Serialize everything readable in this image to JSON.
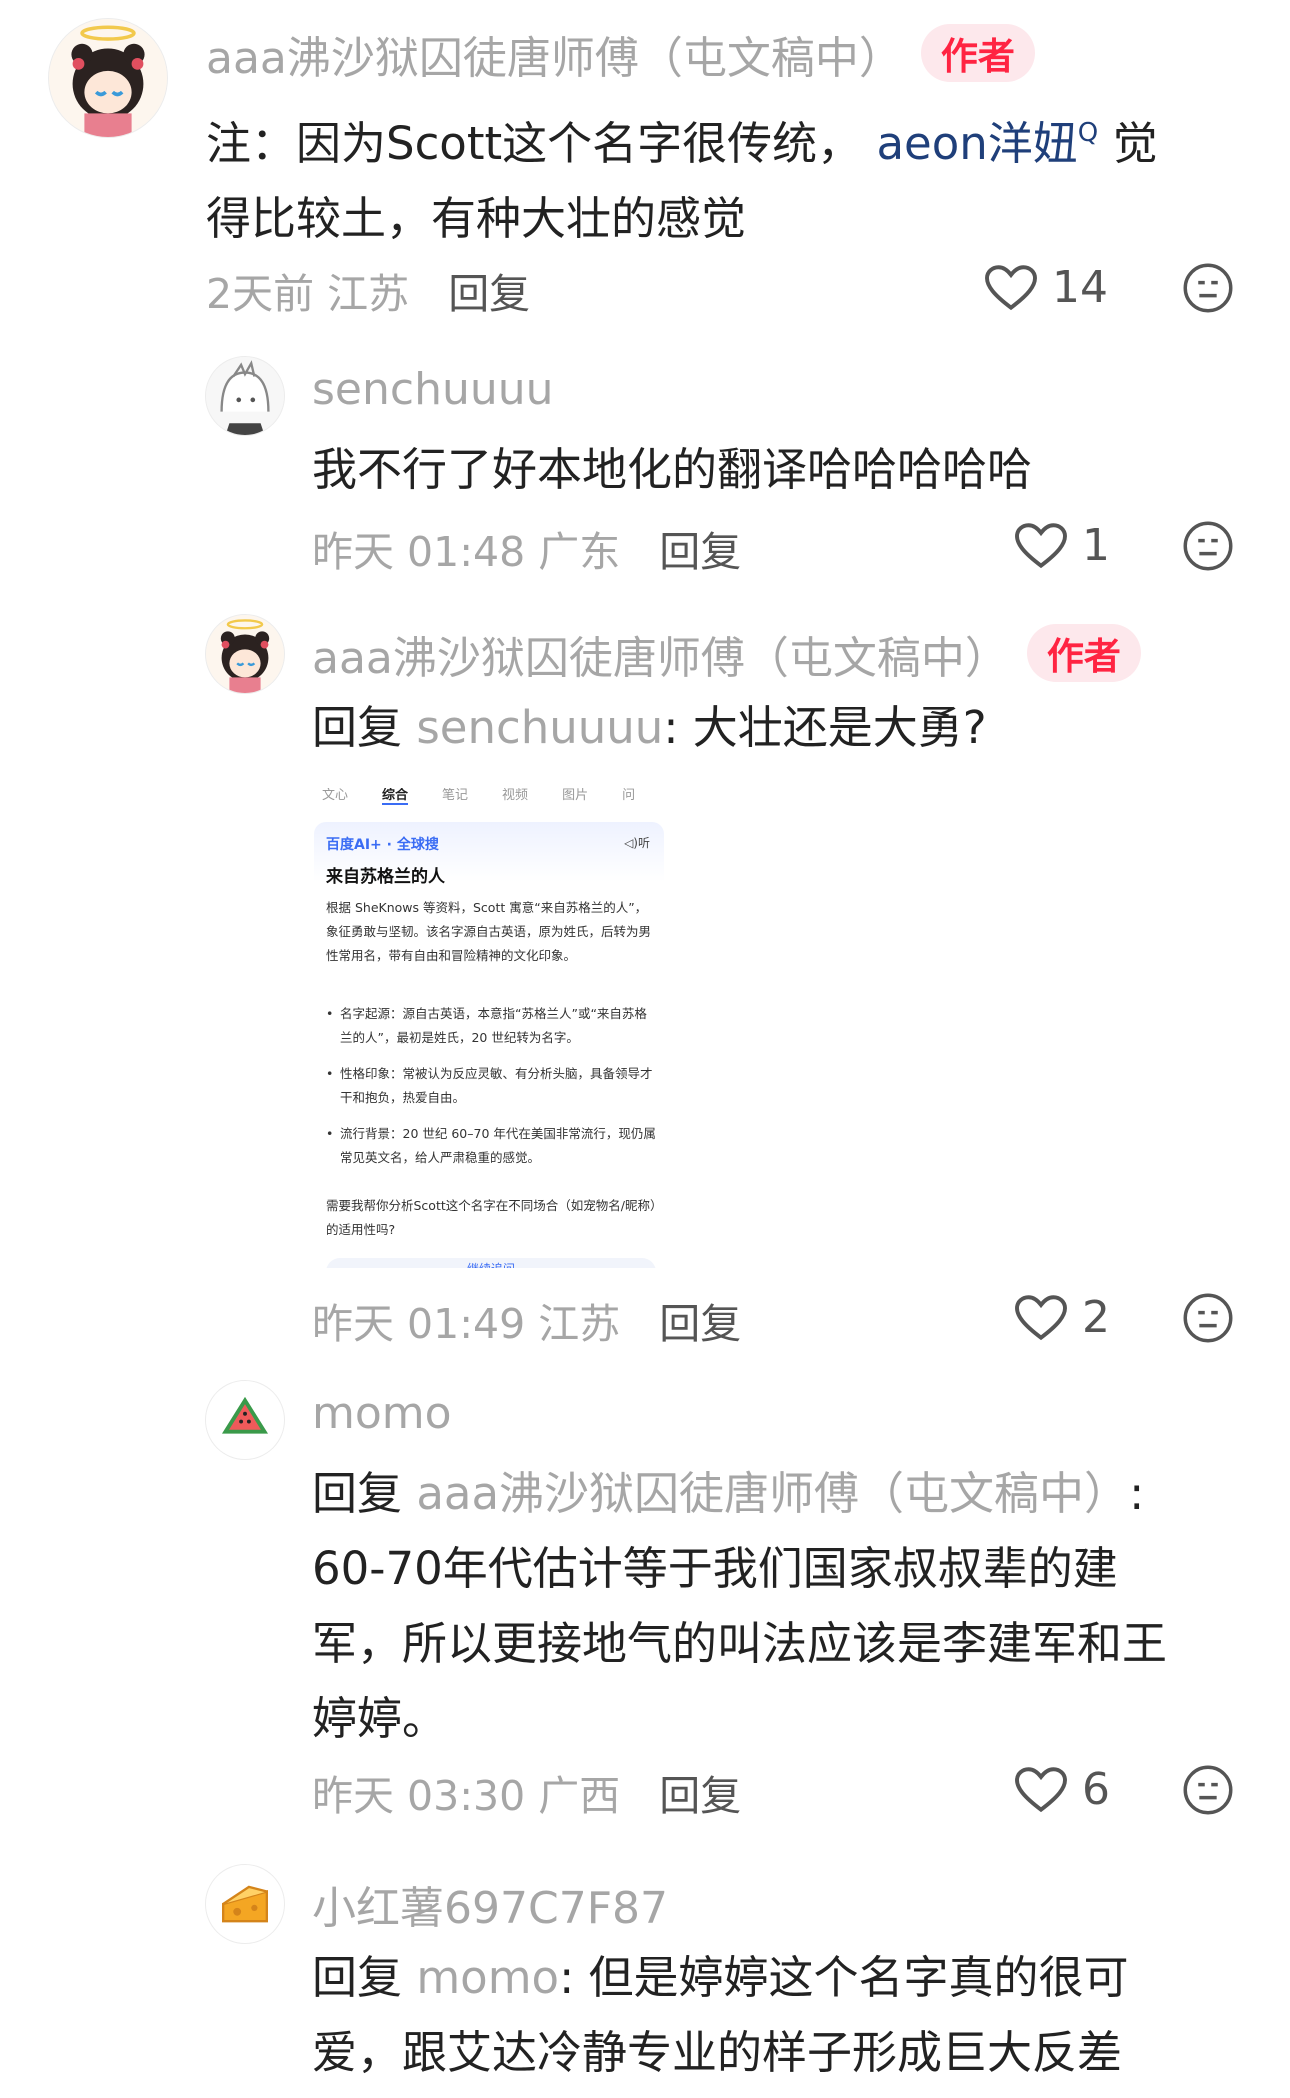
{
  "comments": [
    {
      "name": "aaa沸沙狱囚徒唐师傅（屯文稿中）",
      "badge": "作者",
      "text_before": "注：因为Scott这个名字很传统，",
      "mention": "aeon洋妞",
      "text_line1_after": "觉",
      "text_line2": "得比较土，有种大壮的感觉",
      "time": "2天前",
      "location": "江苏",
      "reply_label": "回复",
      "likes": "14"
    },
    {
      "name": "senchuuuu",
      "text": "我不行了好本地化的翻译哈哈哈哈哈",
      "time": "昨天 01:48",
      "location": "广东",
      "reply_label": "回复",
      "likes": "1"
    },
    {
      "name": "aaa沸沙狱囚徒唐师傅（屯文稿中）",
      "badge": "作者",
      "reply_prefix": "回复",
      "reply_to": "senchuuuu",
      "text": ": 大壮还是大勇?",
      "time": "昨天 01:49",
      "location": "江苏",
      "reply_label": "回复",
      "likes": "2"
    },
    {
      "name": "momo",
      "reply_prefix": "回复",
      "reply_to": "aaa沸沙狱囚徒唐师傅（屯文稿中）",
      "text_colon": ":",
      "line2": "60-70年代估计等于我们国家叔叔辈的建",
      "line3": "军，所以更接地气的叫法应该是李建军和王",
      "line4": "婷婷。",
      "time": "昨天 03:30",
      "location": "广西",
      "reply_label": "回复",
      "likes": "6"
    },
    {
      "name": "小红薯697C7F87",
      "reply_prefix": "回复",
      "reply_to": "momo",
      "line1_after": ": 但是婷婷这个名字真的很可",
      "line2": "爱，跟艾达冷静专业的样子形成巨大反差"
    }
  ],
  "screenshot": {
    "tabs": [
      "文心",
      "综合",
      "笔记",
      "视频",
      "图片",
      "问"
    ],
    "brand": "百度AI+ · 全球搜",
    "listen": "◁)听",
    "title": "来自苏格兰的人",
    "para1": "根据 SheKnows 等资料，Scott 寓意“来自苏格兰的人”，象征勇敢与坚韧。该名字源自古英语，原为姓氏，后转为男性常用名，带有自由和冒险精神的文化印象。",
    "bullet1": "名字起源：源自古英语，本意指“苏格兰人”或“来自苏格兰的人”，最初是姓氏，20 世纪转为名字。",
    "bullet2": "性格印象：常被认为反应灵敏、有分析头脑，具备领导才干和抱负，热爱自由。",
    "bullet3": "流行背景：20 世纪 60–70 年代在美国非常流行，现仍属常见英文名，给人严肃稳重的感觉。",
    "para2": "需要我帮你分析Scott这个名字在不同场合（如宠物名/昵称）的适用性吗?",
    "follow": "继续追问"
  }
}
